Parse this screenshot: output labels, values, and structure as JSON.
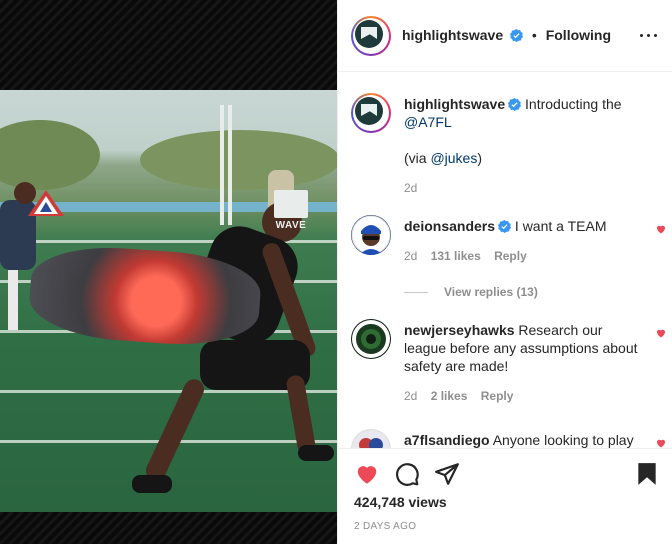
{
  "post": {
    "author": "highlightswave",
    "follow_separator": "•",
    "follow_state": "Following",
    "views": "424,748 views",
    "date": "2 DAYS AGO"
  },
  "media": {
    "watermark_text": "WAVE"
  },
  "caption": {
    "username": "highlightswave",
    "text_before": "Introducting the",
    "mention1": "@A7FL",
    "via_open": "(via ",
    "mention2": "@jukes",
    "via_close": ")",
    "time": "2d"
  },
  "comments": [
    {
      "username": "deionsanders",
      "verified": true,
      "text": "I want a TEAM",
      "time": "2d",
      "likes": "131 likes",
      "reply": "Reply",
      "view_replies": "View replies (13)"
    },
    {
      "username": "newjerseyhawks",
      "verified": false,
      "text": "Research our league before any assumptions about safety are made!",
      "time": "2d",
      "likes": "2 likes",
      "reply": "Reply"
    },
    {
      "username": "a7flsandiego",
      "verified": false,
      "text": "Anyone looking to play"
    }
  ],
  "colors": {
    "like_red": "#ed4956",
    "verified_blue": "#3897f0",
    "link_blue": "#00376b",
    "muted": "#8e8e8e"
  },
  "icons": {
    "like": "heart-filled-icon",
    "comment": "comment-bubble-icon",
    "share": "paper-plane-icon",
    "save": "bookmark-filled-icon",
    "options": "more-horizontal-icon"
  }
}
